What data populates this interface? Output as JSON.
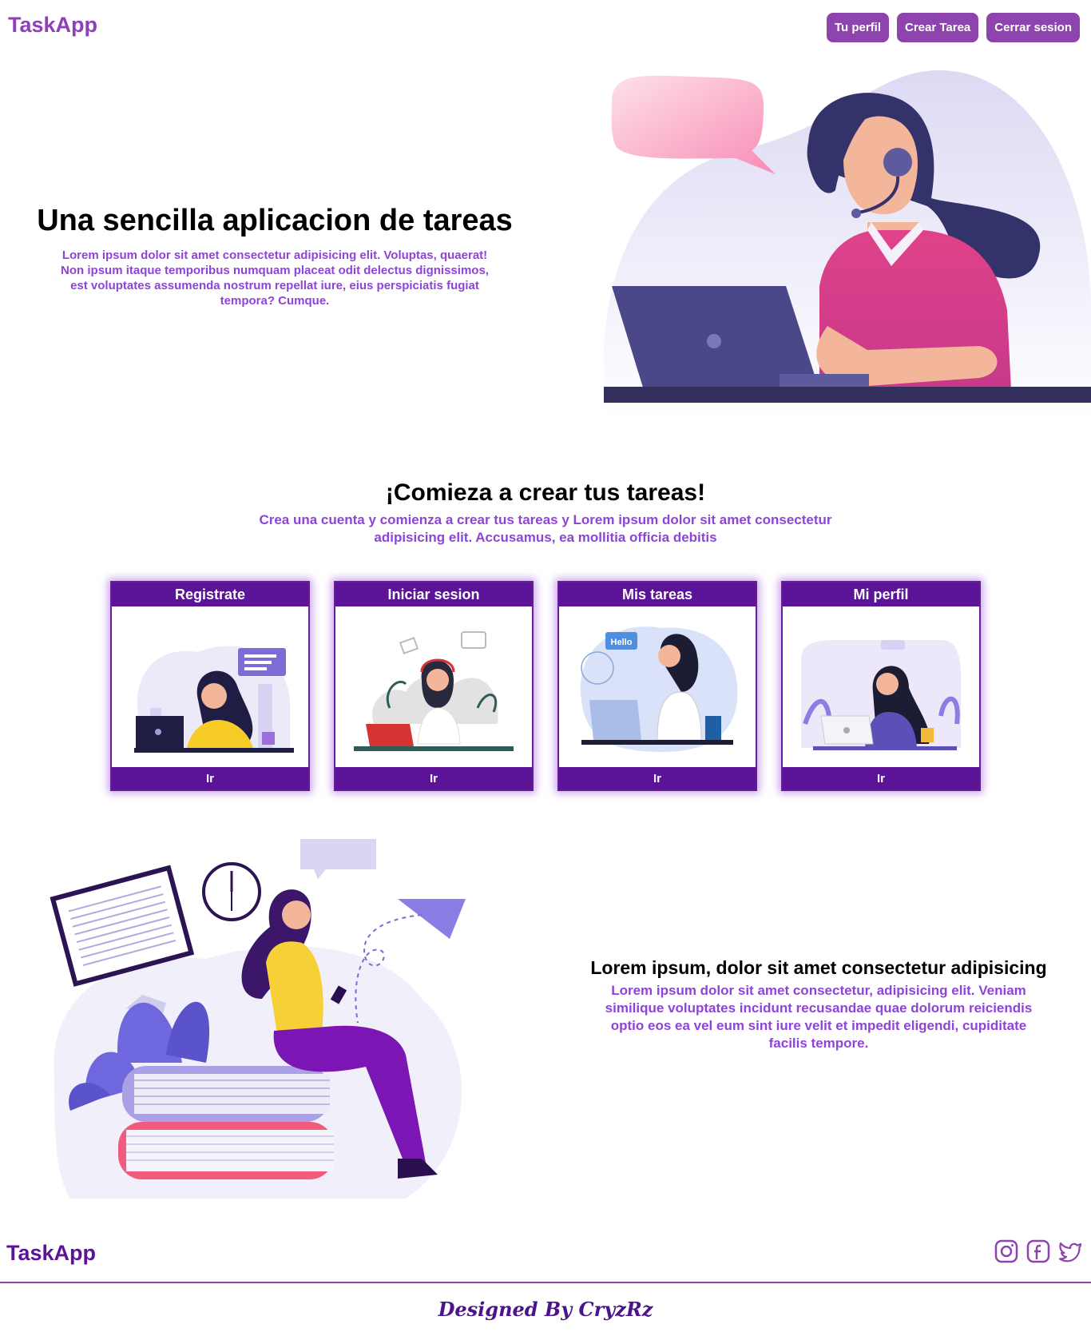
{
  "header": {
    "brand": "TaskApp",
    "nav": [
      "Tu perfil",
      "Crear Tarea",
      "Cerrar sesion"
    ]
  },
  "hero": {
    "title": "Una sencilla aplicacion de tareas",
    "description": "Lorem ipsum dolor sit amet consectetur adipisicing elit. Voluptas, quaerat! Non ipsum itaque temporibus numquam placeat odit delectus dignissimos, est voluptates assumenda nostrum repellat iure, eius perspiciatis fugiat tempora? Cumque."
  },
  "section2": {
    "title": "¡Comieza a crear tus tareas!",
    "description": "Crea una cuenta y comienza a crear tus tareas y Lorem ipsum dolor sit amet consectetur adipisicing elit. Accusamus, ea mollitia officia debitis"
  },
  "cards": [
    {
      "title": "Registrate",
      "action": "Ir"
    },
    {
      "title": "Iniciar sesion",
      "action": "Ir"
    },
    {
      "title": "Mis tareas",
      "action": "Ir",
      "bubble": "Hello"
    },
    {
      "title": "Mi perfil",
      "action": "Ir"
    }
  ],
  "section3": {
    "title": "Lorem ipsum, dolor sit amet consectetur adipisicing",
    "description": "Lorem ipsum dolor sit amet consectetur, adipisicing elit. Veniam similique voluptates incidunt recusandae quae dolorum reiciendis optio eos ea vel eum sint iure velit et impedit eligendi, cupiditate facilis tempore."
  },
  "footer": {
    "brand": "TaskApp",
    "social_icons": [
      "instagram-icon",
      "facebook-icon",
      "twitter-icon"
    ],
    "credits": "Designed By CryzRz"
  },
  "colors": {
    "brand": "#8e3fba",
    "nav_button": "#8e44ad",
    "card_header": "#5b1498",
    "accent_text": "#8e44d8"
  }
}
